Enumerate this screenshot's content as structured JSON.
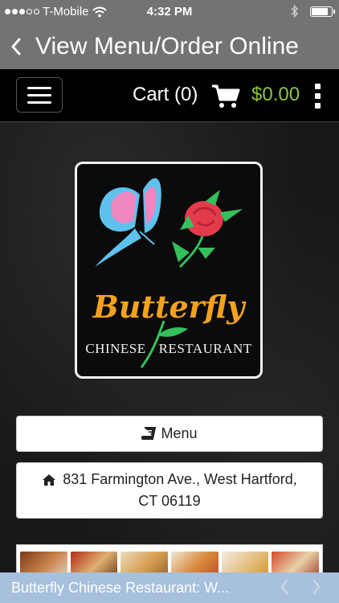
{
  "status_bar": {
    "carrier": "T-Mobile",
    "time": "4:32 PM",
    "signal_strength": 3,
    "battery_level": 0.85
  },
  "nav": {
    "title": "View Menu/Order Online",
    "back_icon": "chevron-left-icon"
  },
  "header": {
    "menu_icon": "hamburger-icon",
    "cart_label": "Cart (0)",
    "cart_icon": "cart-icon",
    "cart_total": "$0.00",
    "more_icon": "kebab-icon",
    "total_color": "#8cc63f"
  },
  "logo": {
    "word": "Butterfly",
    "sub_left": "CHINESE",
    "sub_right": "RESTAURANT"
  },
  "buttons": {
    "menu_label": "Menu",
    "menu_icon": "book-icon",
    "address_line1": "831 Farmington Ave., West Hartford,",
    "address_line2": "CT 06119",
    "address_icon": "home-icon"
  },
  "banner": {
    "title": "Butterfly Chinese Restaurant: W...",
    "prev_icon": "chevron-left-icon",
    "next_icon": "chevron-right-icon"
  }
}
